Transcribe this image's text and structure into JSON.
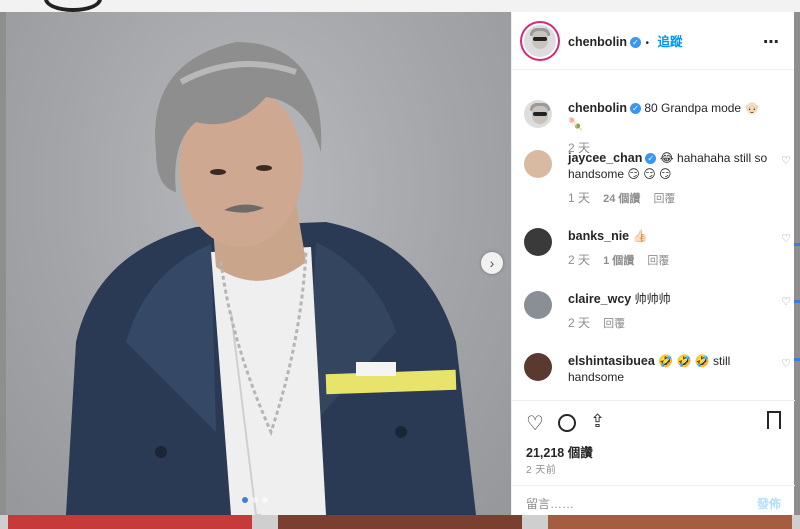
{
  "post": {
    "username": "chenbolin",
    "verified": true,
    "follow_separator": "•",
    "follow_label": "追蹤",
    "more_icon": "⋯",
    "caption": "80 Grandpa mode 👴🏻 🍡",
    "caption_time": "2 天",
    "image_count": 3,
    "active_image": 1
  },
  "comments": [
    {
      "username": "jaycee_chan",
      "verified": true,
      "text": "😂 hahahaha still so handsome 😏 😏 😏",
      "time": "1 天",
      "likes": "24 個讚",
      "reply": "回覆"
    },
    {
      "username": "banks_nie",
      "verified": false,
      "text": "👍🏻",
      "time": "2 天",
      "likes": "1 個讚",
      "reply": "回覆"
    },
    {
      "username": "claire_wcy",
      "verified": false,
      "text": "帅帅帅",
      "time": "2 天",
      "likes": "",
      "reply": "回覆"
    },
    {
      "username": "elshintasibuea",
      "verified": false,
      "text": "🤣 🤣 🤣 still handsome",
      "time": "",
      "likes": "",
      "reply": ""
    }
  ],
  "actions": {
    "like_count": "21,218 個讚",
    "posted_ago": "2 天前"
  },
  "composer": {
    "placeholder": "留言……",
    "post_label": "發佈"
  },
  "colors": {
    "link_blue": "#0095f6",
    "verified_blue": "#3897f0",
    "muted": "#8e8e8e"
  }
}
